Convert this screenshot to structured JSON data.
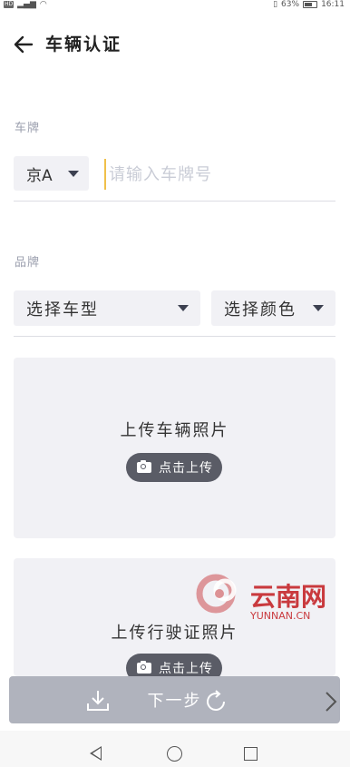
{
  "status_bar": {
    "left_badge": "HD",
    "battery": "63%",
    "time": "16:11"
  },
  "header": {
    "back_icon": "arrow-left-icon",
    "title": "车辆认证"
  },
  "plate_section": {
    "label": "车牌",
    "province_value": "京A",
    "plate_placeholder": "请输入车牌号"
  },
  "brand_section": {
    "label": "品牌",
    "model_select": "选择车型",
    "color_select": "选择颜色"
  },
  "uploads": [
    {
      "title": "上传车辆照片",
      "button": "点击上传"
    },
    {
      "title": "上传行驶证照片",
      "button": "点击上传"
    }
  ],
  "watermark": {
    "text": "云南网",
    "sub": "YUNNAN.CN"
  },
  "footer": {
    "next_label": "下一步"
  },
  "colors": {
    "accent_caret": "#f0c04a",
    "button_disabled": "#b0b3bd",
    "field_bg": "#f1f1f5",
    "label": "#9b9fae"
  }
}
